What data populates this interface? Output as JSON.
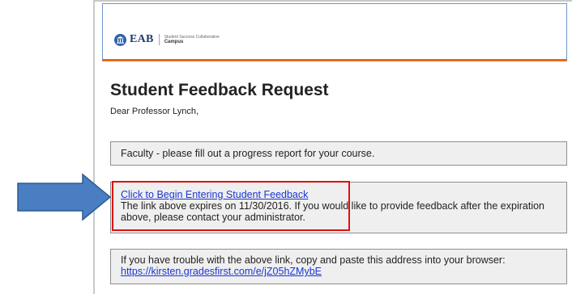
{
  "header": {
    "brand": "EAB",
    "tagline_small": "Student Success Collaborative",
    "tagline_product": "Campus"
  },
  "email": {
    "title": "Student Feedback Request",
    "greeting": "Dear Professor Lynch,",
    "box1_text": "Faculty - please fill out a progress report for your course.",
    "feedback_link": "Click to Begin Entering Student Feedback",
    "expiry_text": "The link above expires on 11/30/2016. If you would like to provide feedback after the expiration above, please contact your administrator.",
    "trouble_text": "If you have trouble with the above link, copy and paste this address into your browser:",
    "trouble_url": "https://kirsten.gradesfirst.com/e/jZ05hZMybE"
  },
  "colors": {
    "accent_blue": "#4a7ec3",
    "highlight_red": "#e01010",
    "header_orange": "#e56b1f",
    "link_blue": "#1a36d4"
  },
  "icons": [
    "columned-building-icon",
    "right-arrow-icon"
  ]
}
